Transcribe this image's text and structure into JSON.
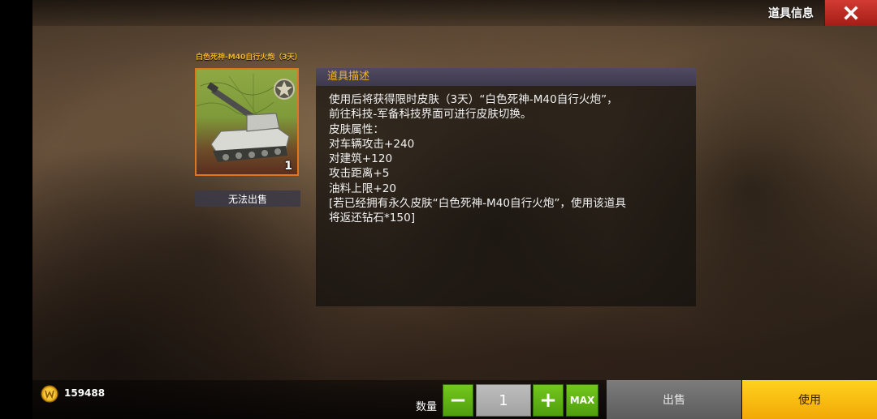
{
  "header": {
    "title": "道具信息",
    "close_icon": "close-icon"
  },
  "item": {
    "name": "白色死神-M40自行火炮（3天）",
    "count": "1",
    "sell_status": "无法出售",
    "icon": "self-propelled-gun-icon",
    "frame_color": "#e0761e"
  },
  "description": {
    "header": "道具描述",
    "lines": [
      "使用后将获得限时皮肤（3天）“白色死神-M40自行火炮”，",
      "前往科技-军备科技界面可进行皮肤切换。",
      "皮肤属性：",
      "对车辆攻击+240",
      "对建筑+120",
      "攻击距离+5",
      "油料上限+20",
      "[若已经拥有永久皮肤“白色死神-M40自行火炮”，使用该道具",
      "将返还钻石*150]"
    ]
  },
  "footer": {
    "gold_icon": "gold-coin-icon",
    "gold_amount": "159488",
    "quantity_label": "数量",
    "quantity_value": "1",
    "minus_label": "−",
    "plus_label": "+",
    "max_label": "MAX",
    "sell_label": "出售",
    "use_label": "使用"
  },
  "colors": {
    "accent_gold": "#f0b52a",
    "green_button": "#5fb51a",
    "use_button": "#f7b90f",
    "close_button": "#c42d25"
  }
}
